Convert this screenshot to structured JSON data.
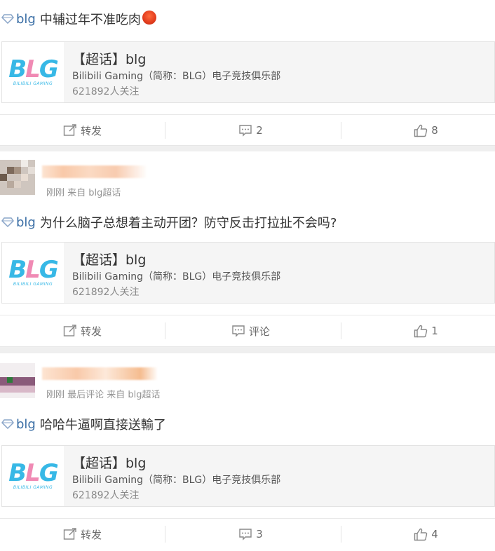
{
  "posts": [
    {
      "text": "中辅过年不准吃肉",
      "topic": "blg",
      "card": {
        "title": "【超话】blg",
        "desc": "Bilibili Gaming（简称：BLG）电子竞技俱乐部",
        "fans": "621892人关注",
        "logo_text": "BLG",
        "logo_sub": "BILIBILI GAMING"
      },
      "actions": {
        "repost": "转发",
        "comment": "2",
        "like": "8"
      }
    },
    {
      "meta": "刚刚 来自 blg超话",
      "topic": "blg",
      "text": "为什么脑子总想着主动开团？防守反击打拉扯不会吗?",
      "card": {
        "title": "【超话】blg",
        "desc": "Bilibili Gaming（简称：BLG）电子竞技俱乐部",
        "fans": "621892人关注",
        "logo_text": "BLG",
        "logo_sub": "BILIBILI GAMING"
      },
      "actions": {
        "repost": "转发",
        "comment": "评论",
        "like": "1"
      }
    },
    {
      "meta": "刚刚 最后评论 来自 blg超话",
      "topic": "blg",
      "text": "哈哈牛逼啊直接送輸了",
      "card": {
        "title": "【超话】blg",
        "desc": "Bilibili Gaming（简称：BLG）电子竞技俱乐部",
        "fans": "621892人关注",
        "logo_text": "BLG",
        "logo_sub": "BILIBILI GAMING"
      },
      "actions": {
        "repost": "转发",
        "comment": "3",
        "like": "4"
      }
    }
  ],
  "colors": {
    "topic": "#3a6ea5",
    "logo_blue": "#37b8e6",
    "logo_pink": "#f08ab4",
    "gap": "#efefef"
  }
}
